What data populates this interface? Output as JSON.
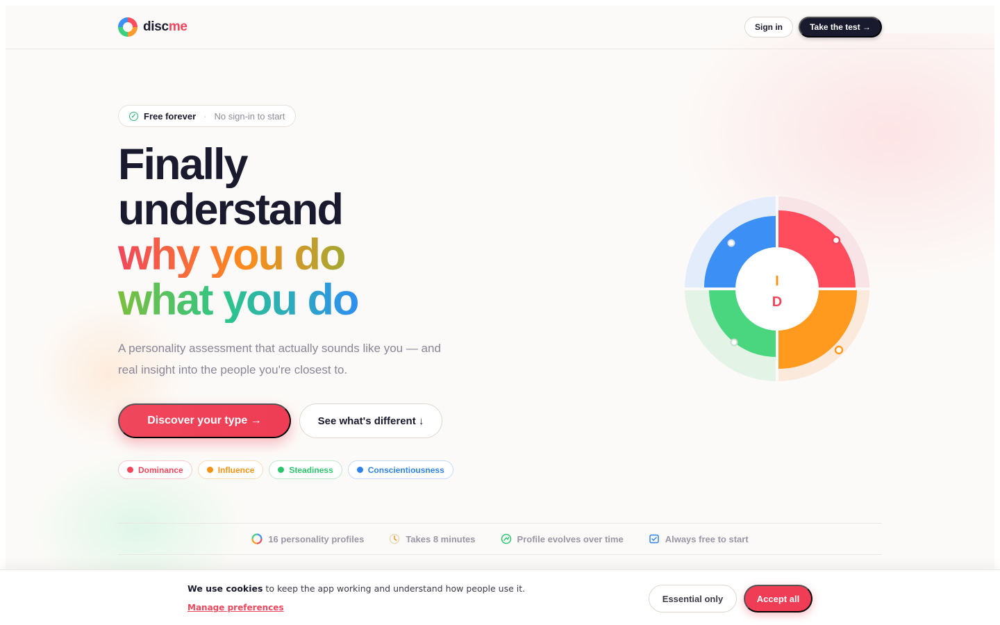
{
  "brand": {
    "name_part1": "disc",
    "name_part2": "me"
  },
  "header": {
    "signin_label": "Sign in",
    "take_test_label": "Take the test →"
  },
  "badge": {
    "primary": "Free forever",
    "separator": "·",
    "secondary": "No sign-in to start"
  },
  "hero": {
    "line1": "Finally",
    "line2": "understand",
    "line3": "why you do",
    "line4": "what you do",
    "subtitle": "A personality assessment that actually sounds like you — and real insight into the people you're closest to."
  },
  "cta": {
    "primary_label": "Discover your type →",
    "secondary_label": "See what's different ↓"
  },
  "traits": [
    {
      "label": "Dominance",
      "color": "#f0475c",
      "border": "#f6c9cf"
    },
    {
      "label": "Influence",
      "color": "#f39214",
      "border": "#f8dcb8"
    },
    {
      "label": "Steadiness",
      "color": "#2cc56c",
      "border": "#bfe8cf"
    },
    {
      "label": "Conscientiousness",
      "color": "#2f82e8",
      "border": "#c4daf5"
    }
  ],
  "features": [
    {
      "label": "16 personality profiles",
      "icon": "color-wheel-icon"
    },
    {
      "label": "Takes 8 minutes",
      "icon": "clock-icon"
    },
    {
      "label": "Profile evolves over time",
      "icon": "growth-icon"
    },
    {
      "label": "Always free to start",
      "icon": "checkbox-icon"
    }
  ],
  "wheel": {
    "center_top_letter": "I",
    "center_bottom_letter": "D",
    "quadrant_colors": {
      "top_left": "#3b8ff5",
      "top_right": "#ff4d5e",
      "bottom_right": "#ff9a1f",
      "bottom_left": "#4ad67f"
    }
  },
  "cookie": {
    "bold": "We use cookies",
    "text": " to keep the app working and understand how people use it.",
    "manage_label": "Manage preferences",
    "essential_label": "Essential only",
    "accept_label": "Accept all"
  }
}
